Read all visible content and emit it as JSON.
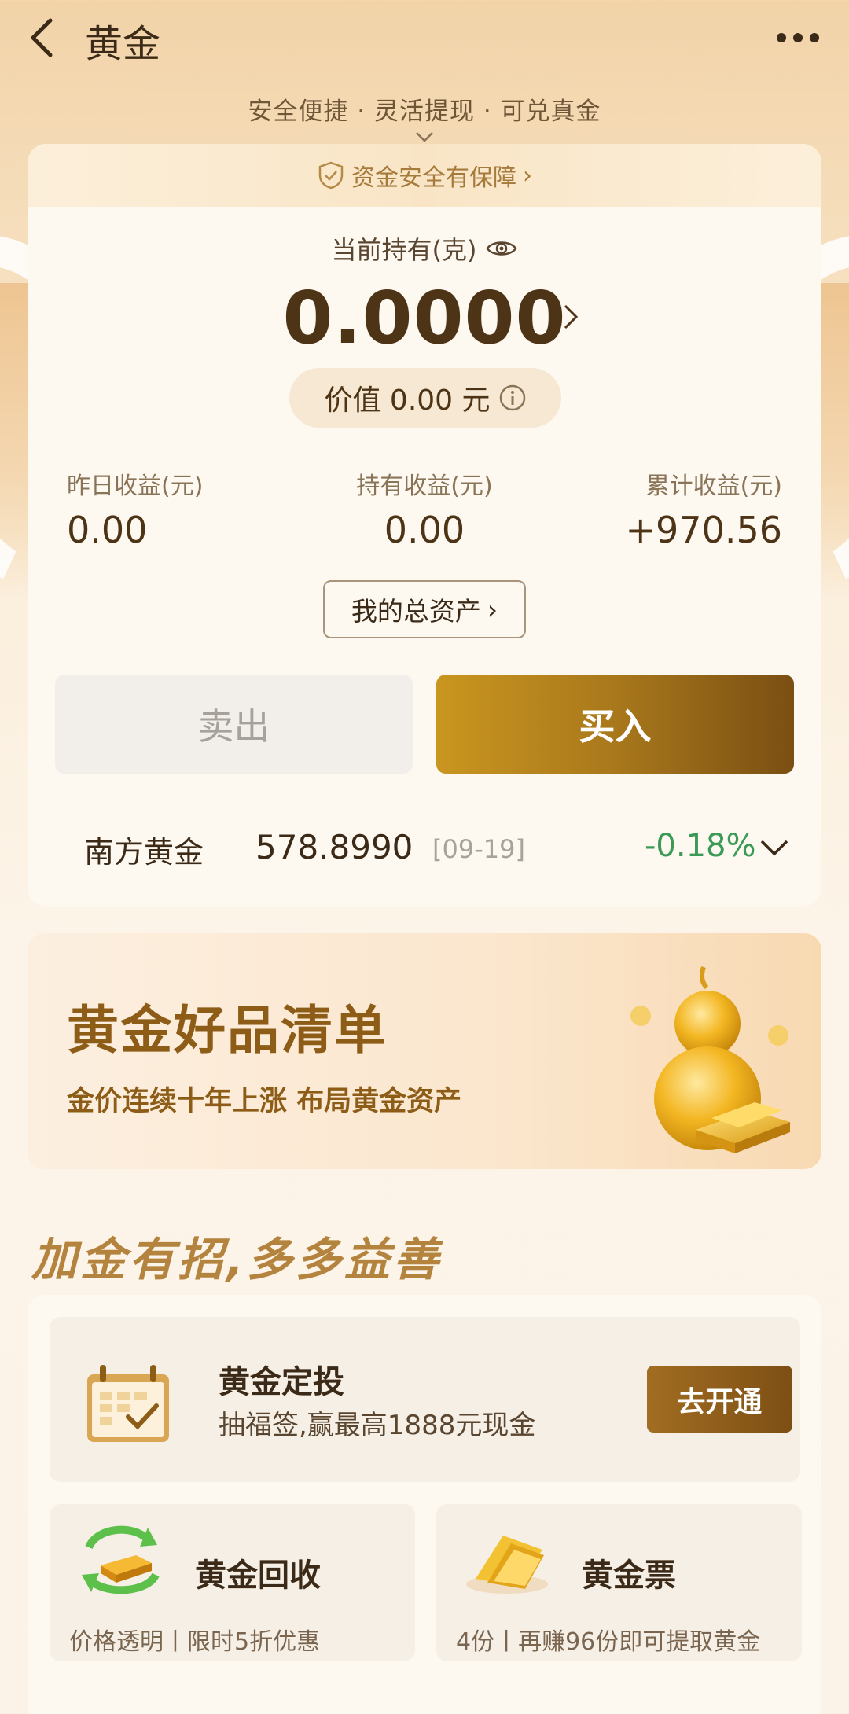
{
  "header": {
    "title": "黄金"
  },
  "slogan": "安全便捷 · 灵活提现 · 可兑真金",
  "main_card": {
    "guarantee": "资金安全有保障",
    "holding_label": "当前持有(克)",
    "holding_value": "0.0000",
    "value_label": "价值 0.00 元",
    "stats": [
      {
        "label": "昨日收益(元)",
        "value": "0.00"
      },
      {
        "label": "持有收益(元)",
        "value": "0.00"
      },
      {
        "label": "累计收益(元)",
        "value": "+970.56"
      }
    ],
    "assets_button": "我的总资产",
    "sell_button": "卖出",
    "buy_button": "买入",
    "price_row": {
      "name": "南方黄金",
      "price": "578.8990",
      "date": "[09-19]",
      "change": "-0.18%"
    }
  },
  "banner": {
    "title": "黄金好品清单",
    "subtitle": "金价连续十年上涨 布局黄金资产"
  },
  "section_title": "加金有招,多多益善",
  "features": {
    "invest": {
      "title": "黄金定投",
      "subtitle": "抽福签,赢最高1888元现金",
      "button": "去开通"
    },
    "recycle": {
      "title": "黄金回收",
      "subtitle": "价格透明丨限时5折优惠"
    },
    "ticket": {
      "title": "黄金票",
      "subtitle": "4份丨再赚96份即可提取黄金"
    }
  },
  "colors": {
    "brand_gold": "#a9781c",
    "text_dark": "#3b2a17",
    "change_green": "#3b9a55"
  }
}
